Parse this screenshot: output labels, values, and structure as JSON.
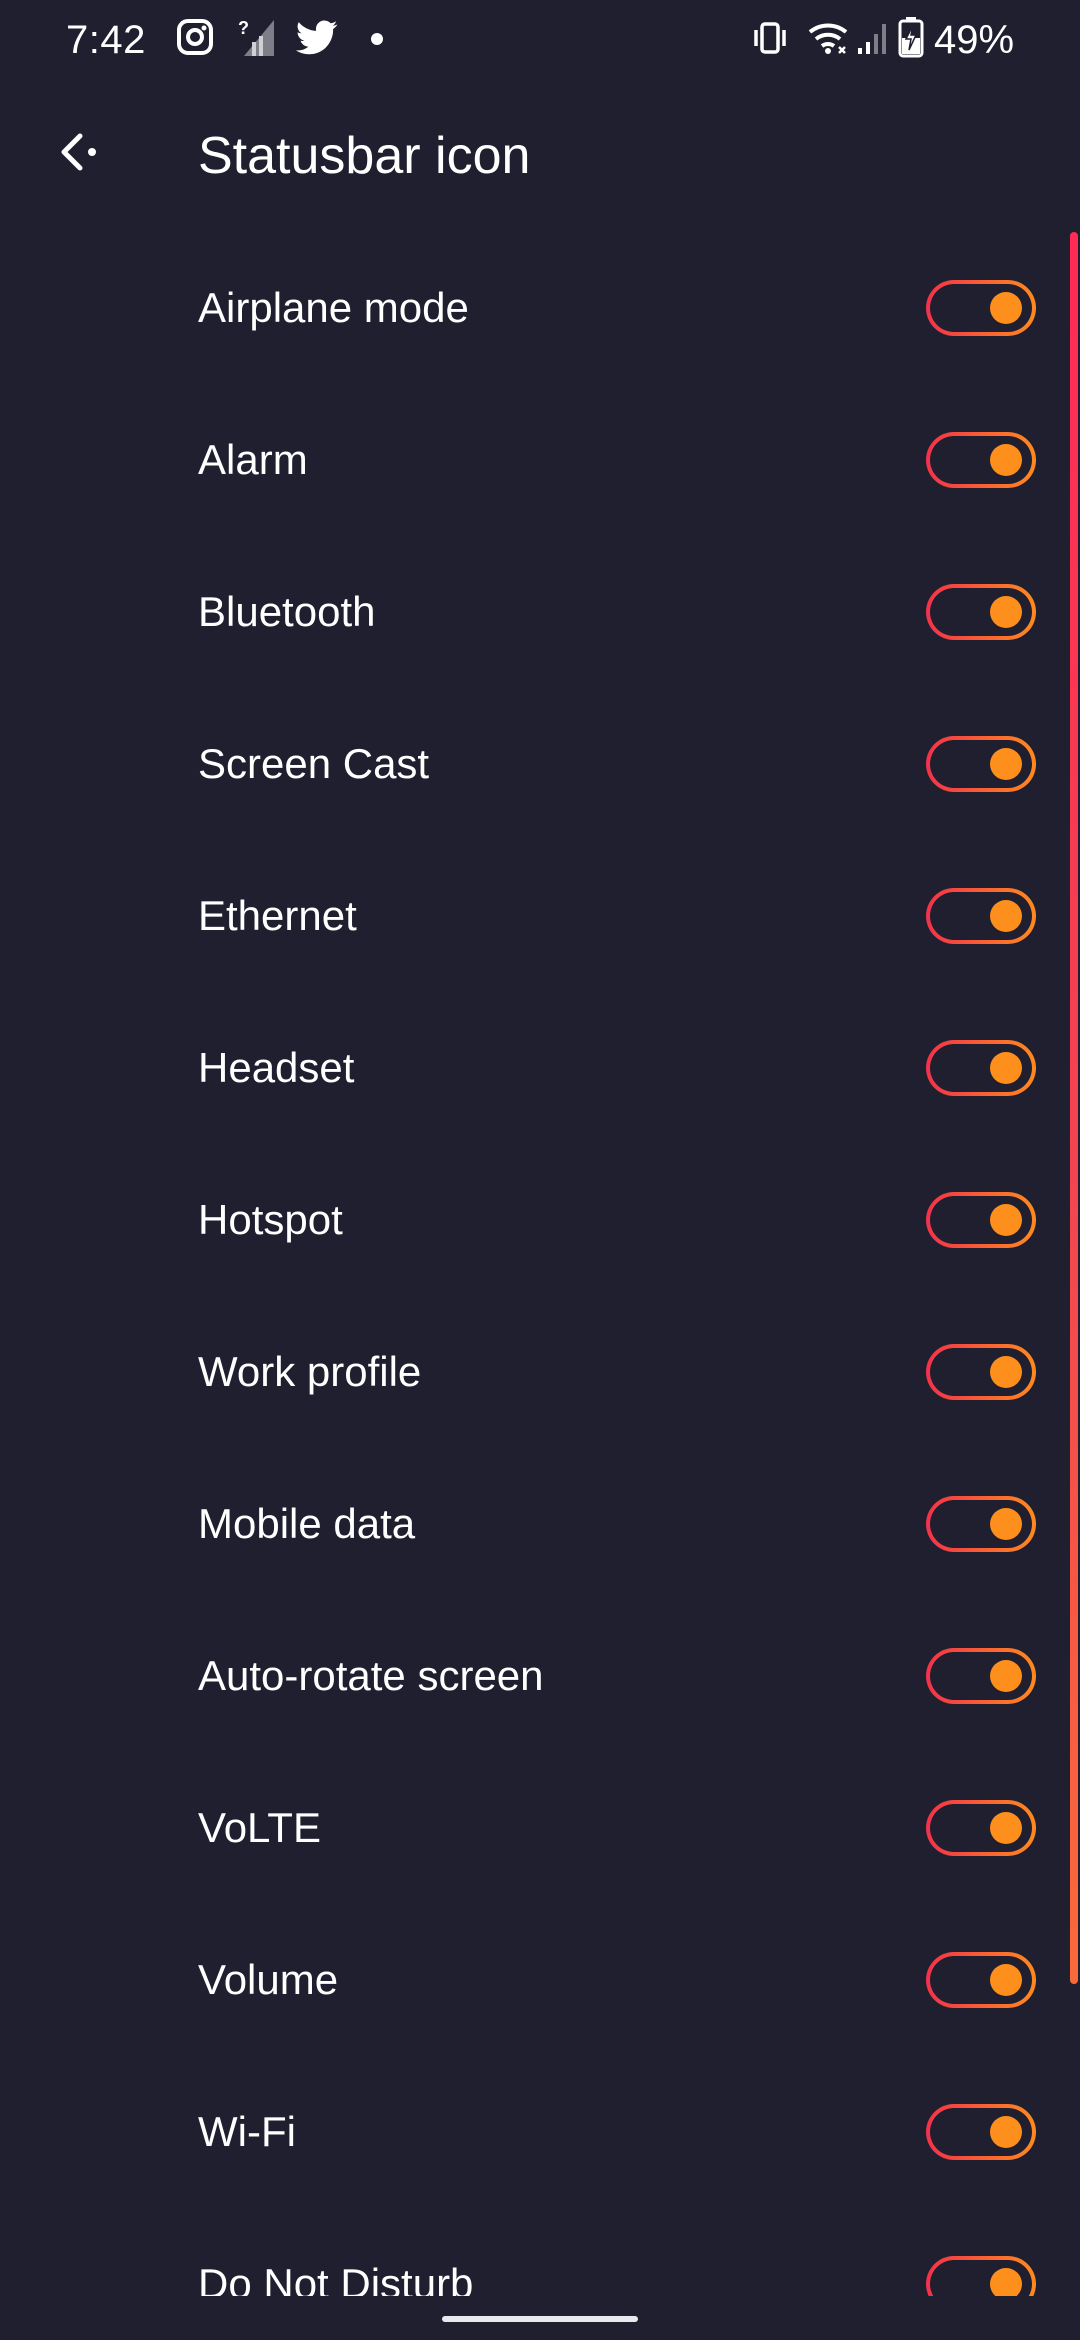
{
  "status_bar": {
    "time": "7:42",
    "battery_percent": "49%",
    "notification_icons": [
      "instagram-icon",
      "signal-unknown-icon",
      "twitter-icon",
      "dot-icon"
    ],
    "system_icons": [
      "vibrate-icon",
      "wifi-icon",
      "cell-signal-icon",
      "battery-charging-icon"
    ]
  },
  "header": {
    "back_icon": "back-arrow-icon",
    "title": "Statusbar icon"
  },
  "items": [
    {
      "label": "Airplane mode",
      "enabled": true
    },
    {
      "label": "Alarm",
      "enabled": true
    },
    {
      "label": "Bluetooth",
      "enabled": true
    },
    {
      "label": "Screen Cast",
      "enabled": true
    },
    {
      "label": "Ethernet",
      "enabled": true
    },
    {
      "label": "Headset",
      "enabled": true
    },
    {
      "label": "Hotspot",
      "enabled": true
    },
    {
      "label": "Work profile",
      "enabled": true
    },
    {
      "label": "Mobile data",
      "enabled": true
    },
    {
      "label": "Auto-rotate screen",
      "enabled": true
    },
    {
      "label": "VoLTE",
      "enabled": true
    },
    {
      "label": "Volume",
      "enabled": true
    },
    {
      "label": "Wi-Fi",
      "enabled": true
    },
    {
      "label": "Do Not Disturb",
      "enabled": true
    }
  ],
  "colors": {
    "background": "#201f2f",
    "accent_start": "#f2324c",
    "accent_end": "#ff8a1f",
    "text": "#ffffff"
  }
}
